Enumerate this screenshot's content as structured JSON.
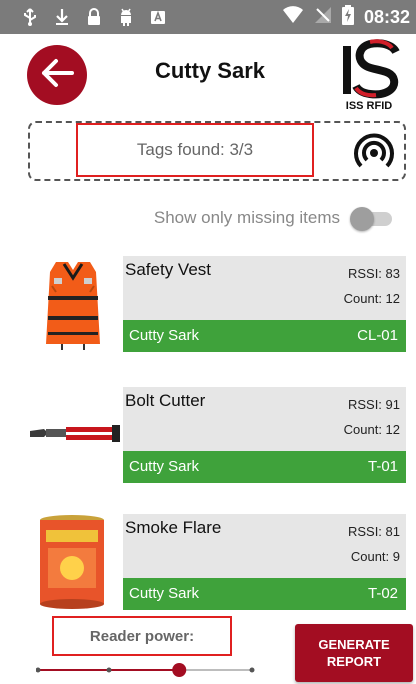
{
  "status_bar": {
    "time": "08:32",
    "icons": [
      "usb-icon",
      "download-icon",
      "lock-icon",
      "android-icon",
      "keyboard-icon",
      "wifi-icon",
      "no-signal-icon",
      "battery-charging-icon"
    ]
  },
  "header": {
    "title": "Cutty Sark",
    "logo_text": "ISS RFID"
  },
  "tags": {
    "label": "Tags found: 3/3"
  },
  "filter": {
    "label": "Show only missing items",
    "enabled": false
  },
  "items": [
    {
      "name": "Safety Vest",
      "rssi": "RSSI: 83",
      "count": "Count: 12",
      "location": "Cutty Sark",
      "code": "CL-01"
    },
    {
      "name": "Bolt Cutter",
      "rssi": "RSSI: 91",
      "count": "Count: 12",
      "location": "Cutty Sark",
      "code": "T-01"
    },
    {
      "name": "Smoke Flare",
      "rssi": "RSSI: 81",
      "count": "Count: 9",
      "location": "Cutty Sark",
      "code": "T-02"
    }
  ],
  "reader_power": {
    "label": "Reader power:",
    "level": 0.66
  },
  "generate_button": {
    "line1": "GENERATE",
    "line2": "REPORT"
  },
  "colors": {
    "accent_red": "#a30d22",
    "location_green": "#3fa23b",
    "highlight_red": "#e02020"
  }
}
